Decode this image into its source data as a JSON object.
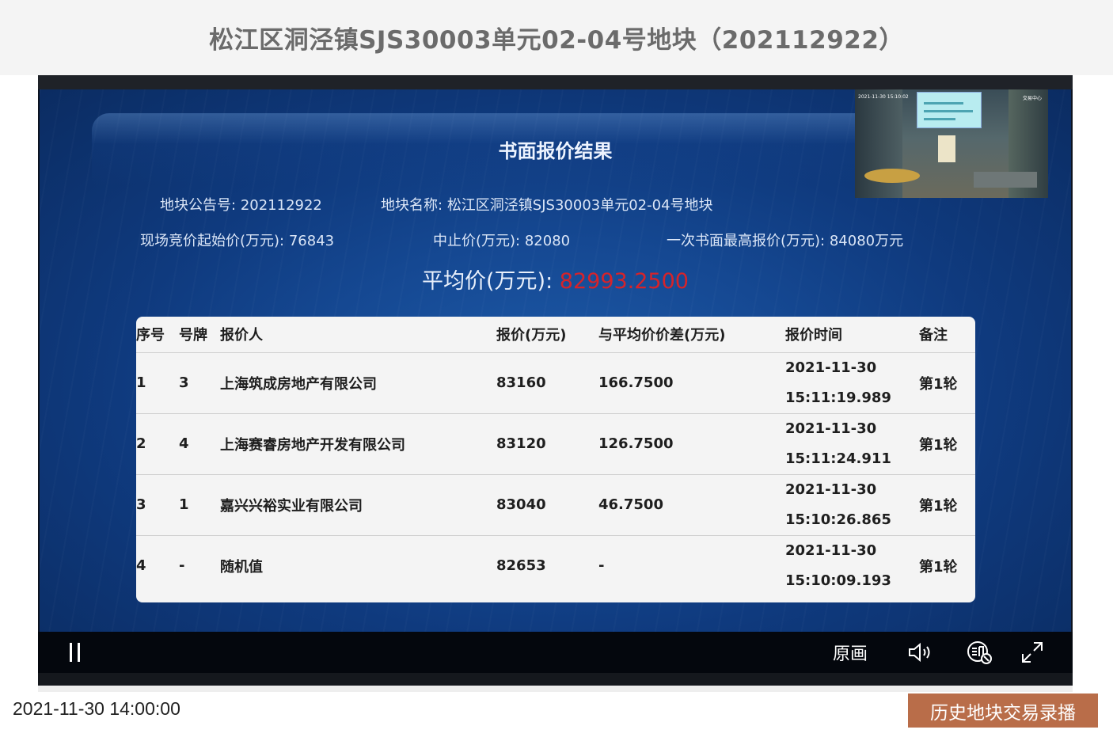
{
  "header": {
    "title": "松江区洞泾镇SJS30003单元02-04号地块（202112922）"
  },
  "screen": {
    "result_title": "书面报价结果",
    "notice_label": "地块公告号:",
    "notice_no": "202112922",
    "land_label": "地块名称:",
    "land_name": "松江区洞泾镇SJS30003单元02-04号地块",
    "start_price_label": "现场竞价起始价(万元):",
    "start_price": "76843",
    "stop_price_label": "中止价(万元):",
    "stop_price": "82080",
    "max_bid_label": "一次书面最高报价(万元):",
    "max_bid": "84080万元",
    "avg_label": "平均价(万元):",
    "avg_value": "82993.2500"
  },
  "table": {
    "headers": [
      "序号",
      "号牌",
      "报价人",
      "报价(万元)",
      "与平均价价差(万元)",
      "报价时间",
      "备注"
    ],
    "rows": [
      {
        "seq": "1",
        "plate": "3",
        "bidder": "上海筑成房地产有限公司",
        "price": "83160",
        "diff": "166.7500",
        "date": "2021-11-30",
        "time": "15:11:19.989",
        "note": "第1轮"
      },
      {
        "seq": "2",
        "plate": "4",
        "bidder": "上海赛睿房地产开发有限公司",
        "price": "83120",
        "diff": "126.7500",
        "date": "2021-11-30",
        "time": "15:11:24.911",
        "note": "第1轮"
      },
      {
        "seq": "3",
        "plate": "1",
        "bidder": "嘉兴兴裕实业有限公司",
        "price": "83040",
        "diff": "46.7500",
        "date": "2021-11-30",
        "time": "15:10:26.865",
        "note": "第1轮"
      },
      {
        "seq": "4",
        "plate": "-",
        "bidder": "随机值",
        "price": "82653",
        "diff": "-",
        "date": "2021-11-30",
        "time": "15:10:09.193",
        "note": "第1轮"
      }
    ]
  },
  "pip": {
    "stamp": "2021-11-30 15:10:02",
    "brand": "交易中心"
  },
  "controls": {
    "quality_label": "原画",
    "icons": [
      "pause-icon",
      "volume-icon",
      "danmaku-icon",
      "fullscreen-icon"
    ]
  },
  "footer": {
    "date": "2021-11-30 14:00:00",
    "history_button": "历史地块交易录播"
  },
  "colors": {
    "header_bg": "#f4f4f4",
    "accent_button": "#b96d49",
    "avg_price": "#d6232a"
  }
}
